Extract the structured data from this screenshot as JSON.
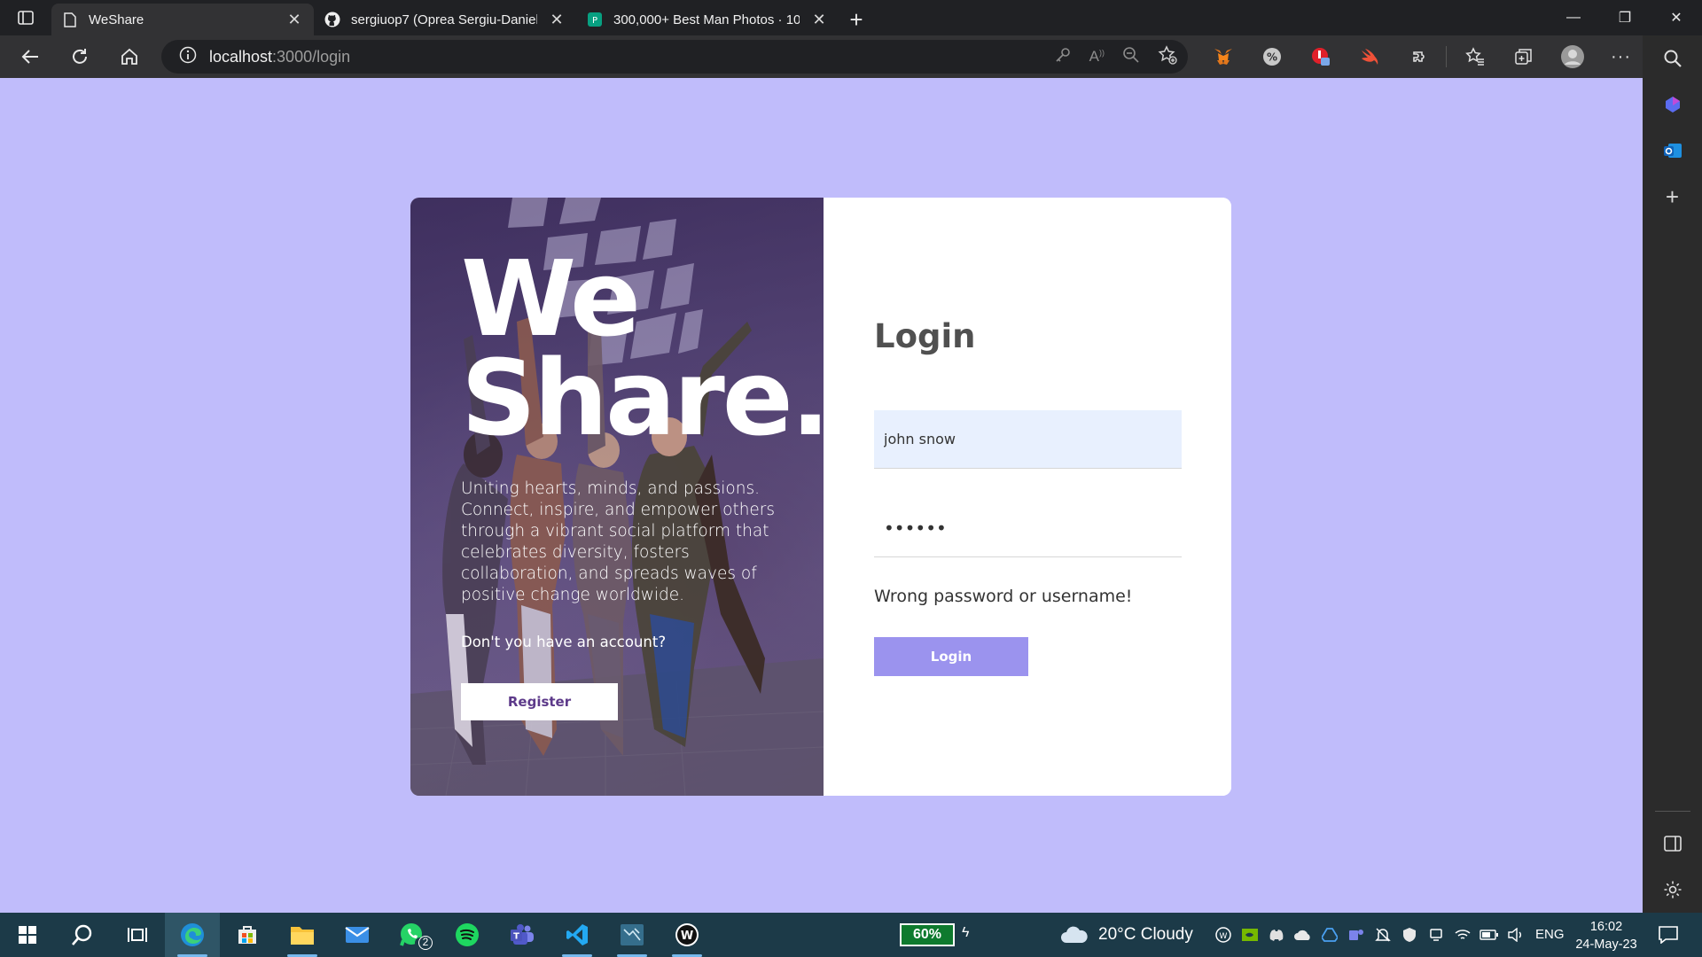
{
  "browser": {
    "tabs": [
      {
        "title": "WeShare",
        "active": true,
        "icon": "page-icon"
      },
      {
        "title": "sergiuop7 (Oprea Sergiu-Daniel)",
        "active": false,
        "icon": "github-icon"
      },
      {
        "title": "300,000+ Best Man Photos · 100",
        "active": false,
        "icon": "pexels-icon"
      }
    ],
    "address": {
      "host": "localhost",
      "path": ":3000/login"
    }
  },
  "left_panel": {
    "title_line1": "We",
    "title_line2": "Share.",
    "description": "Uniting hearts, minds, and passions. Connect, inspire, and empower others through a vibrant social platform that celebrates diversity, fosters collaboration, and spreads waves of positive change worldwide.",
    "question": "Don't you have an account?",
    "register_label": "Register"
  },
  "login": {
    "title": "Login",
    "username_value": "john snow",
    "password_value": "••••••",
    "error": "Wrong password or username!",
    "button_label": "Login"
  },
  "taskbar": {
    "badge_whatsapp": "2",
    "battery": "60%",
    "weather": "20°C  Cloudy",
    "lang": "ENG",
    "time": "16:02",
    "date": "24-May-23"
  },
  "colors": {
    "page_bg": "#c0bcfb",
    "login_button": "#9b93ee",
    "register_text": "#5d3a8a"
  }
}
